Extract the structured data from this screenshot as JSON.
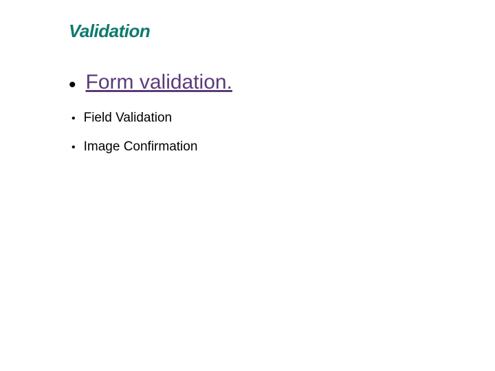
{
  "slide": {
    "title": "Validation",
    "items": [
      {
        "label": "Form validation.",
        "type": "link"
      },
      {
        "label": "Field Validation",
        "type": "text"
      },
      {
        "label": "Image Confirmation",
        "type": "text"
      }
    ]
  }
}
